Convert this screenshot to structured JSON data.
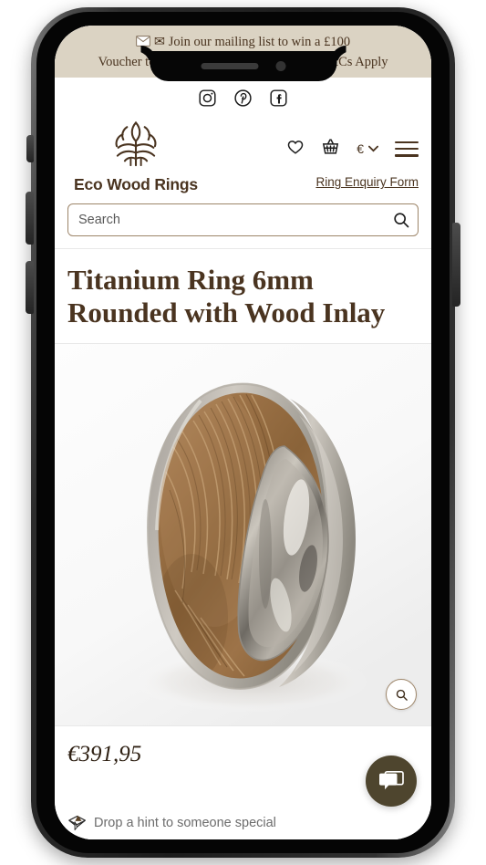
{
  "device": {
    "type": "smartphone-mockup",
    "notch": {
      "speaker": "speaker-grille",
      "camera": "front-camera"
    }
  },
  "promo": {
    "icon": "envelope-icon",
    "text": "Join our mailing list to win a £100 Voucher to put towards your dream ring - T&Cs Apply",
    "line1": "✉ Join our mailing list to win a £100",
    "line2": "Voucher to put towards your dream ring - T&Cs Apply",
    "background_color": "#dbd3c3",
    "text_color": "#4a3420"
  },
  "header": {
    "social": [
      {
        "name": "instagram-icon",
        "label": "Instagram"
      },
      {
        "name": "pinterest-icon",
        "label": "Pinterest"
      },
      {
        "name": "facebook-icon",
        "label": "Facebook"
      }
    ],
    "brand_name": "Eco Wood Rings",
    "logo": "tree-logo",
    "nav_icons": [
      {
        "name": "wishlist-heart-icon",
        "label": "Wishlist"
      },
      {
        "name": "shopping-basket-icon",
        "label": "Basket"
      }
    ],
    "currency": {
      "symbol": "€",
      "chevron": "chevron-down-icon"
    },
    "menu": "hamburger-menu-icon",
    "enquiry_link": "Ring Enquiry Form",
    "brand_color": "#4a3420"
  },
  "search": {
    "placeholder": "Search",
    "value": "",
    "icon": "search-icon"
  },
  "product": {
    "title": "Titanium Ring 6mm Rounded with Wood Inlay",
    "price": "€391,95",
    "currency_code": "EUR",
    "image_alt": "Titanium ring with wood inlay",
    "zoom_button": "zoom-search-icon"
  },
  "footer": {
    "hint_icon": "send-hint-envelope-icon",
    "hint_text": "Drop a hint to someone special"
  },
  "chat": {
    "icon": "chat-bubbles-icon",
    "color": "#4e452e"
  }
}
